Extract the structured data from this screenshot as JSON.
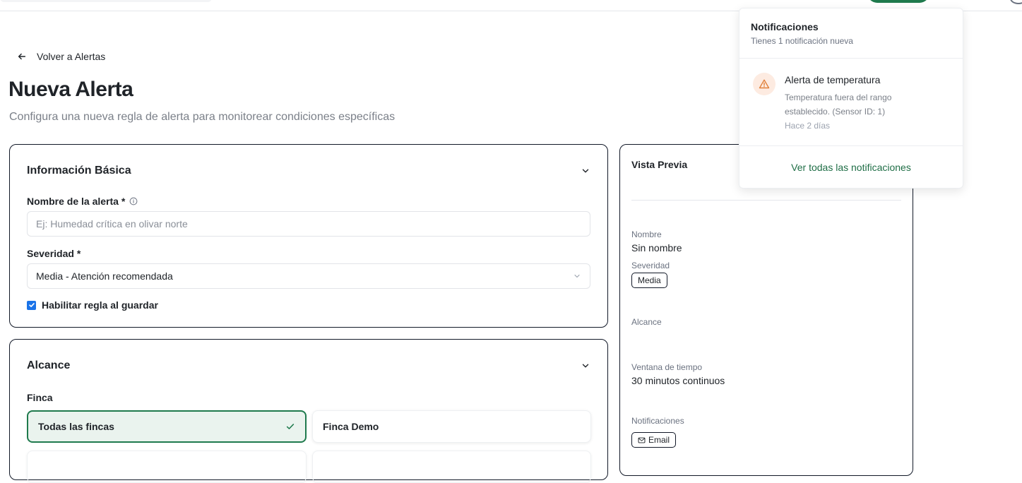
{
  "nav": {
    "back_label": "Volver a Alertas"
  },
  "page": {
    "title": "Nueva Alerta",
    "subtitle": "Configura una nueva regla de alerta para monitorear condiciones específicas"
  },
  "basic_info": {
    "title": "Información Básica",
    "name_label": "Nombre de la alerta *",
    "name_placeholder": "Ej: Humedad crítica en olivar norte",
    "name_value": "",
    "severity_label": "Severidad *",
    "severity_value": "Media - Atención recomendada",
    "enable_label": "Habilitar regla al guardar",
    "enable_checked": true
  },
  "scope": {
    "title": "Alcance",
    "farm_label": "Finca",
    "farms": [
      {
        "label": "Todas las fincas",
        "selected": true
      },
      {
        "label": "Finca Demo",
        "selected": false
      }
    ]
  },
  "preview": {
    "title": "Vista Previa",
    "name_label": "Nombre",
    "name_value": "Sin nombre",
    "severity_label": "Severidad",
    "severity_badge": "Media",
    "scope_label": "Alcance",
    "window_label": "Ventana de tiempo",
    "window_value": "30 minutos continuos",
    "notifications_label": "Notificaciones",
    "notifications_badge": "Email"
  },
  "notifications": {
    "title": "Notificaciones",
    "subtitle": "Tienes 1 notificación nueva",
    "items": [
      {
        "title": "Alerta de temperatura",
        "body": "Temperatura fuera del rango establecido. (Sensor ID: 1)",
        "time": "Hace 2 días",
        "icon": "warning-icon"
      }
    ],
    "view_all_label": "Ver todas las notificaciones"
  },
  "colors": {
    "primary_green": "#1f7a4d",
    "checkbox_blue": "#1a73e8",
    "warning_orange": "#e0803a"
  }
}
